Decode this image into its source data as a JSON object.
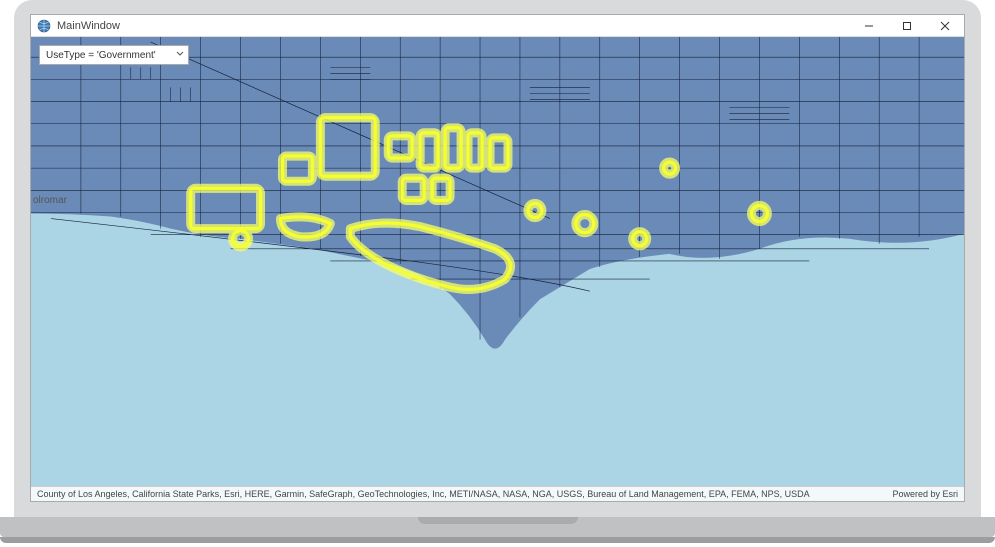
{
  "window": {
    "title": "MainWindow"
  },
  "filter": {
    "expression": "UseType = 'Government'"
  },
  "map": {
    "place_label": "olromar",
    "colors": {
      "ocean": "#abd4e4",
      "terrain": "#b8bda0",
      "parcel_fill": "#6a8bb8",
      "parcel_line": "#0f1a33",
      "highlight_stroke": "#f3ff2e",
      "highlight_glow": "#f9ff66"
    }
  },
  "attribution": {
    "credits": "County of Los Angeles, California State Parks, Esri, HERE, Garmin, SafeGraph, GeoTechnologies, Inc, METI/NASA, NASA, NGA, USGS, Bureau of Land Management, EPA, FEMA, NPS, USDA",
    "powered_by": "Powered by Esri"
  }
}
